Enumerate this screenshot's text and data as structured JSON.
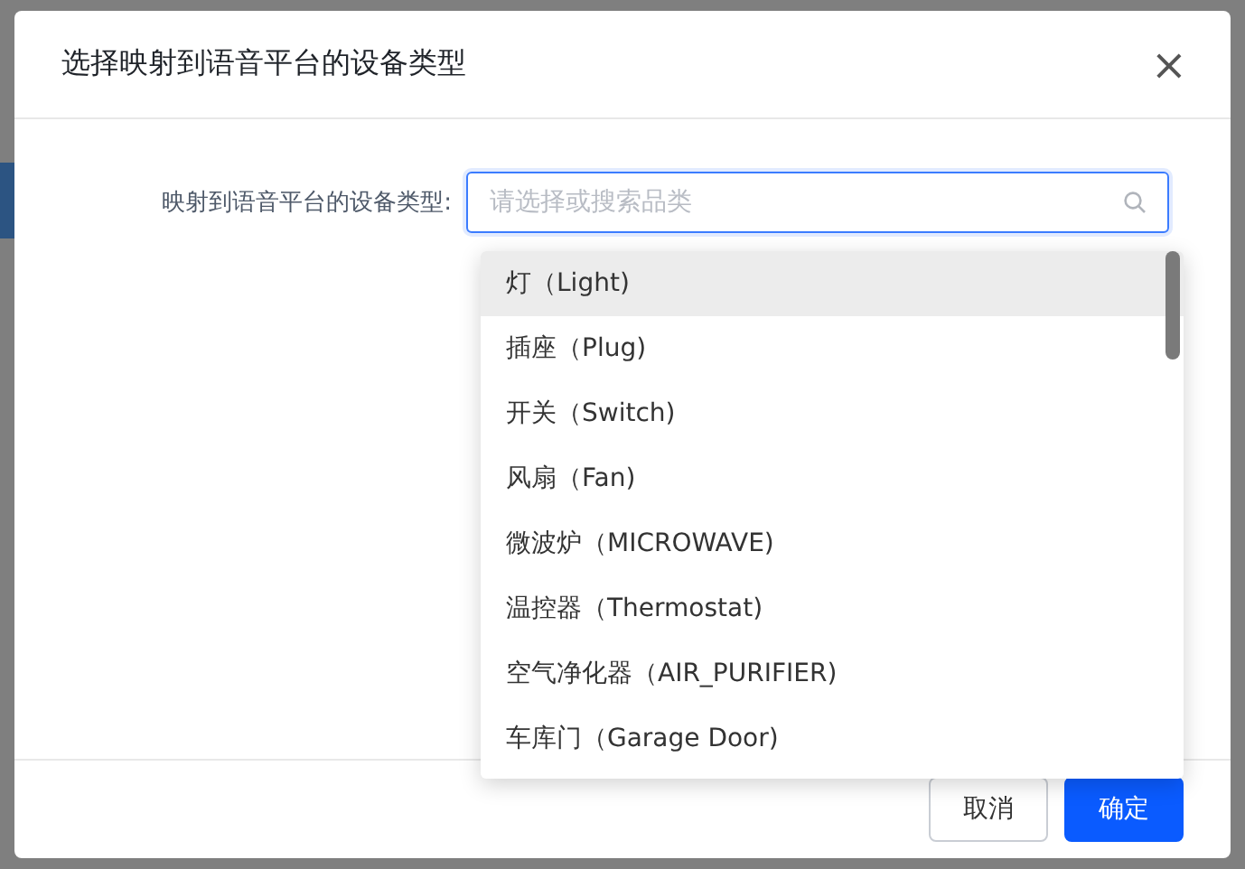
{
  "dialog": {
    "title": "选择映射到语音平台的设备类型",
    "close": "×"
  },
  "form": {
    "label": "映射到语音平台的设备类型:",
    "placeholder": "请选择或搜索品类",
    "focused": true
  },
  "options": [
    {
      "label": "灯（Light)",
      "selected": true
    },
    {
      "label": "插座（Plug)",
      "selected": false
    },
    {
      "label": "开关（Switch)",
      "selected": false
    },
    {
      "label": "风扇（Fan)",
      "selected": false
    },
    {
      "label": "微波炉（MICROWAVE)",
      "selected": false
    },
    {
      "label": "温控器（Thermostat)",
      "selected": false
    },
    {
      "label": "空气净化器（AIR_PURIFIER)",
      "selected": false
    },
    {
      "label": "车库门（Garage Door)",
      "selected": false
    }
  ],
  "buttons": [
    {
      "label": "取消",
      "kind": "secondary"
    },
    {
      "label": "确定",
      "kind": "primary"
    }
  ]
}
